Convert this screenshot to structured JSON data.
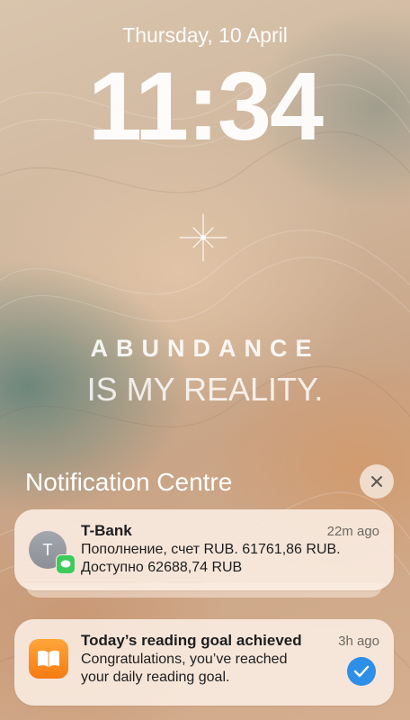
{
  "lockscreen": {
    "date": "Thursday, 10 April",
    "time": "11:34"
  },
  "wallpaper": {
    "line1": "ABUNDANCE",
    "line2": "IS MY REALITY."
  },
  "notification_centre": {
    "title": "Notification Centre",
    "close_icon": "close-icon"
  },
  "notifications": [
    {
      "app": "T-Bank",
      "time": "22m ago",
      "avatar_letter": "T",
      "line1": "Пополнение, счет RUB. 61761,86 RUB.",
      "line2": "Доступно 62688,74 RUB",
      "icon": "messages-icon",
      "badge_color": "#3ccb5a"
    },
    {
      "app": "Today’s reading goal achieved",
      "time": "3h ago",
      "line1": "Congratulations, you’ve reached",
      "line2": "your daily reading goal.",
      "icon": "books-icon",
      "accent": "#f58a1f",
      "status_icon": "checkmark-icon"
    }
  ]
}
